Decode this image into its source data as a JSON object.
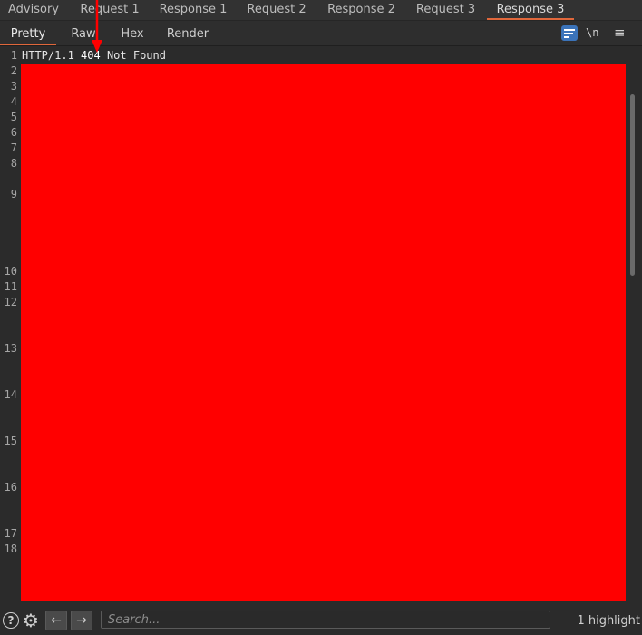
{
  "top_tabs": [
    "Advisory",
    "Request 1",
    "Response 1",
    "Request 2",
    "Response 2",
    "Request 3",
    "Response 3"
  ],
  "active_top_tab": "Response 3",
  "view_tabs": [
    "Pretty",
    "Raw",
    "Hex",
    "Render"
  ],
  "active_view_tab": "Pretty",
  "toolbar": {
    "newline_label": "\\n",
    "menu_icon": "hamburger-icon",
    "wrap_icon": "text-wrap-icon"
  },
  "editor": {
    "line_numbers": [
      "1",
      "2",
      "3",
      "4",
      "5",
      "6",
      "7",
      "8",
      "9",
      "10",
      "11",
      "12",
      "13",
      "14",
      "15",
      "16",
      "17",
      "18"
    ],
    "line1_prefix": "HTTP/1.1 ",
    "line1_status": "404",
    "line1_suffix": " Not Found"
  },
  "bottom": {
    "search_placeholder": "Search...",
    "highlight_count": "1 highlight",
    "back_icon": "arrow-left-icon",
    "forward_icon": "arrow-right-icon"
  },
  "colors": {
    "accent": "#e0673b",
    "redaction": "#ff0000",
    "wrap_button": "#3b73b9"
  }
}
